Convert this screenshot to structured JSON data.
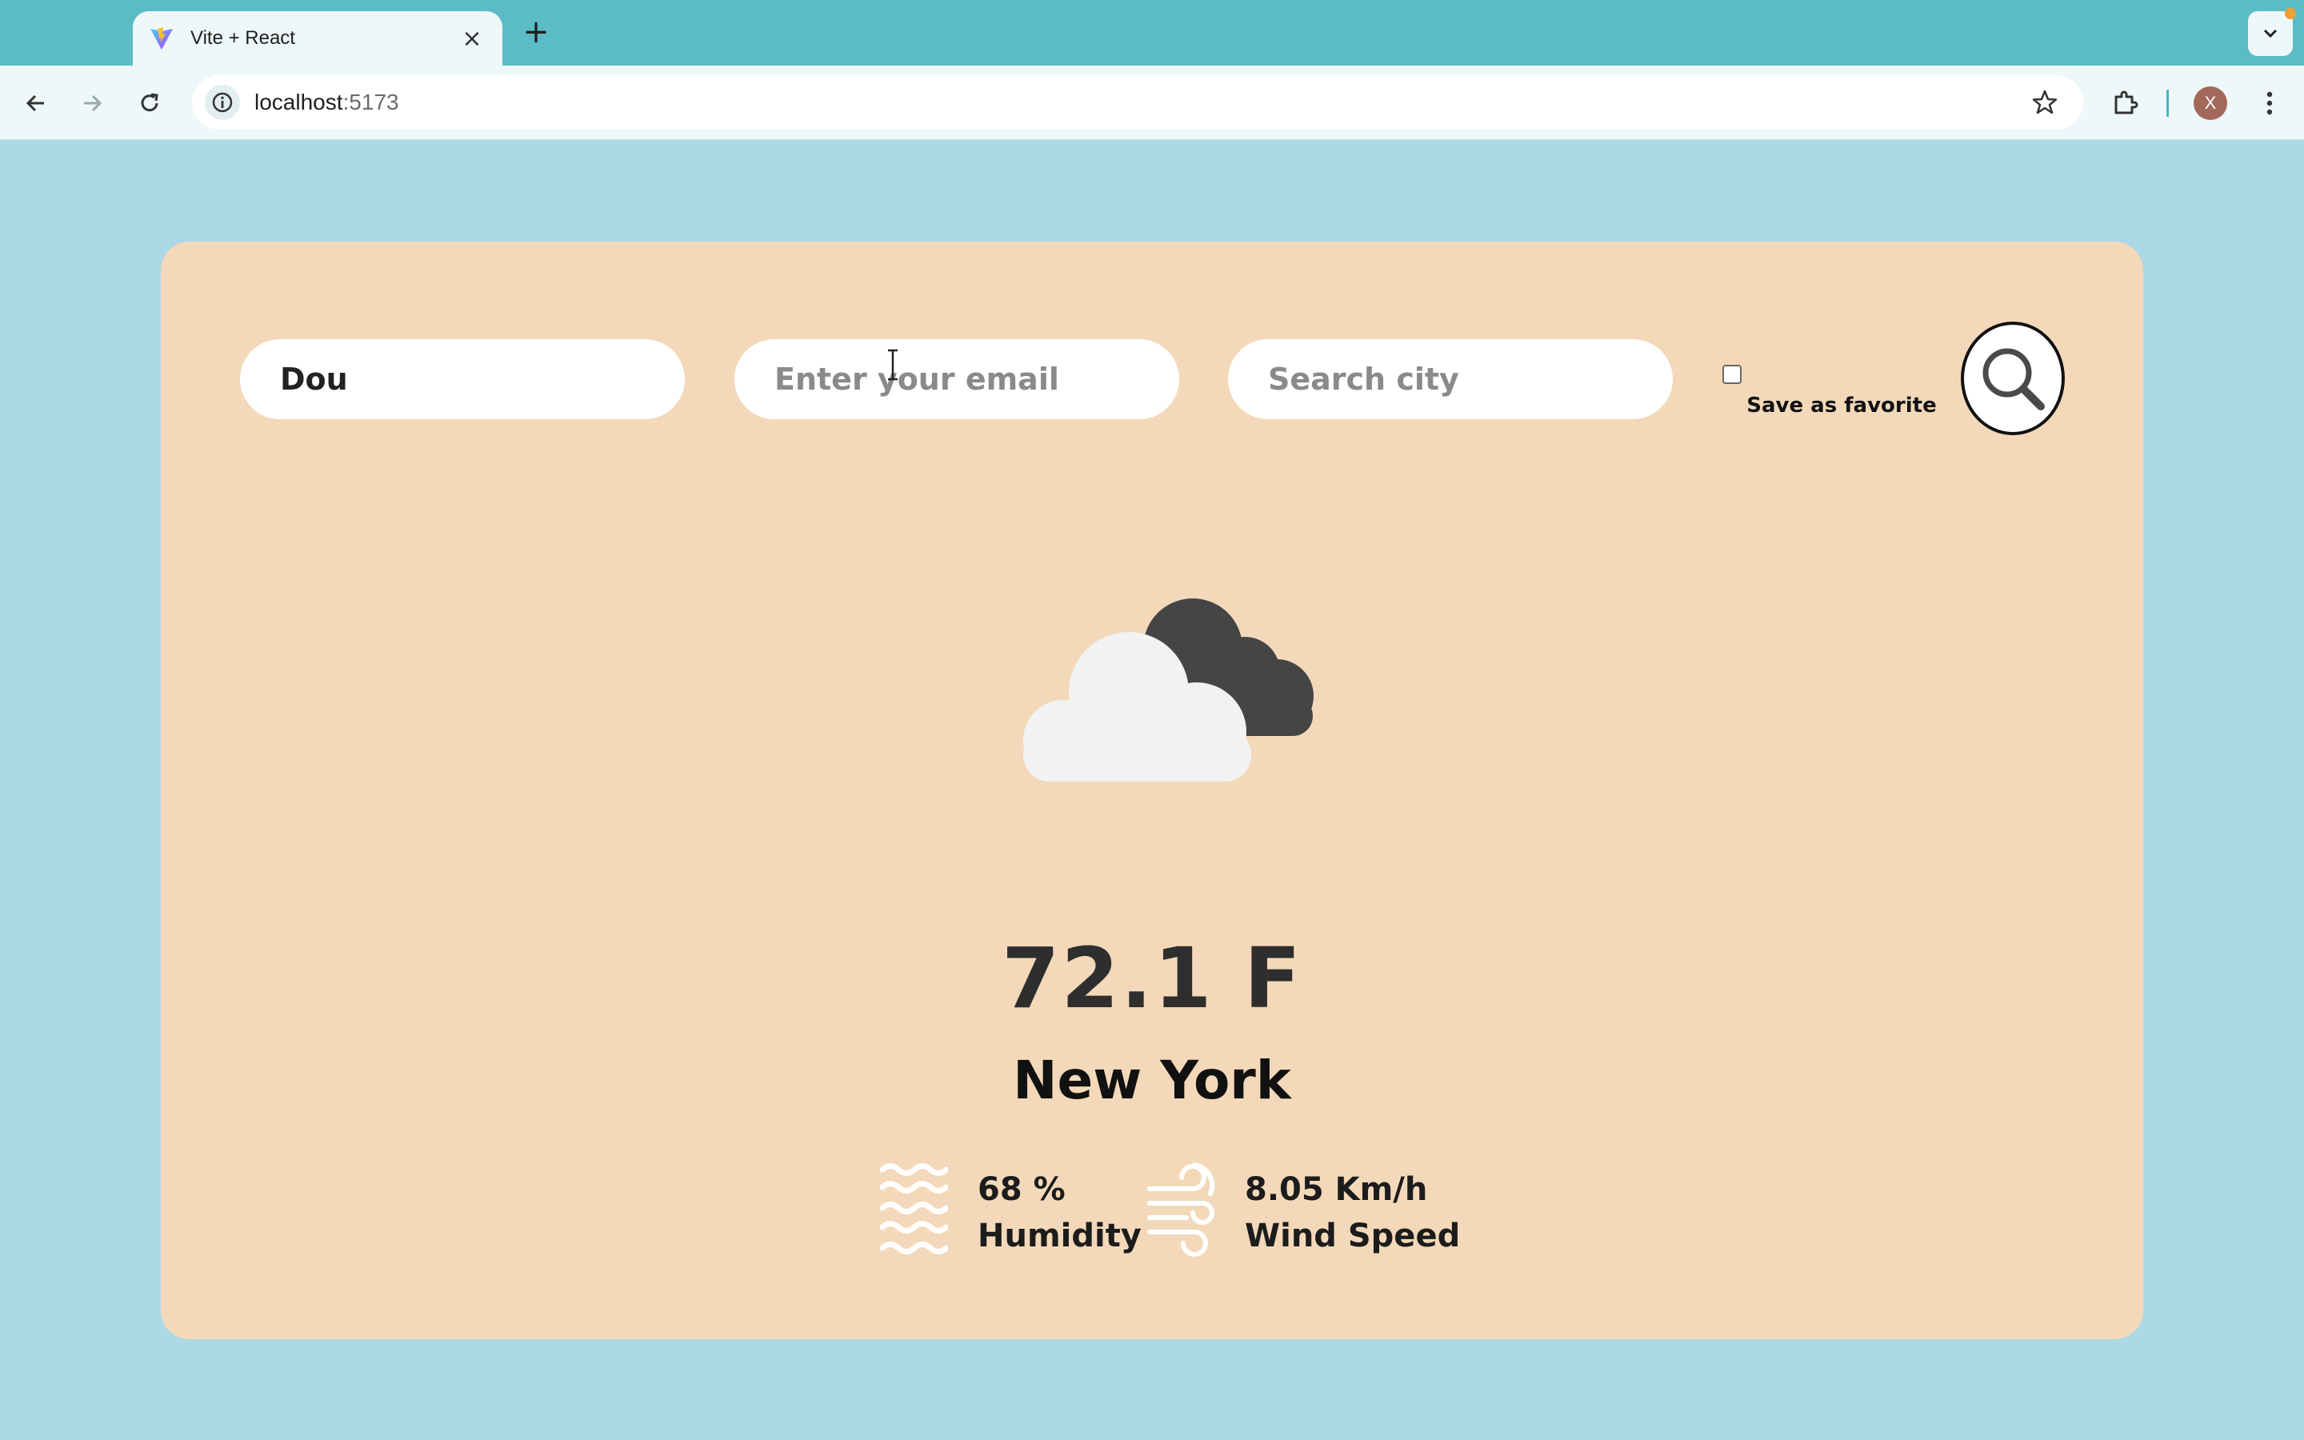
{
  "browser": {
    "tab_title": "Vite + React",
    "url_host": "localhost",
    "url_port": ":5173",
    "profile_initial": "X",
    "colors": {
      "tabstrip": "#5bbcc6",
      "toolbar": "#eef8f9",
      "avatar": "#a2685a"
    }
  },
  "form": {
    "name_value": "Dou",
    "email_placeholder": "Enter your email",
    "city_placeholder": "Search city",
    "favorite_label": "Save as favorite",
    "favorite_checked": false
  },
  "weather": {
    "icon": "cloudy-night-icon",
    "temperature": "72.1 F",
    "city": "New York",
    "humidity_value": "68 %",
    "humidity_label": "Humidity",
    "wind_value": "8.05 Km/h",
    "wind_label": "Wind Speed"
  },
  "colors": {
    "page_bg": "#add8e6",
    "card_bg": "#f3d9b9"
  }
}
